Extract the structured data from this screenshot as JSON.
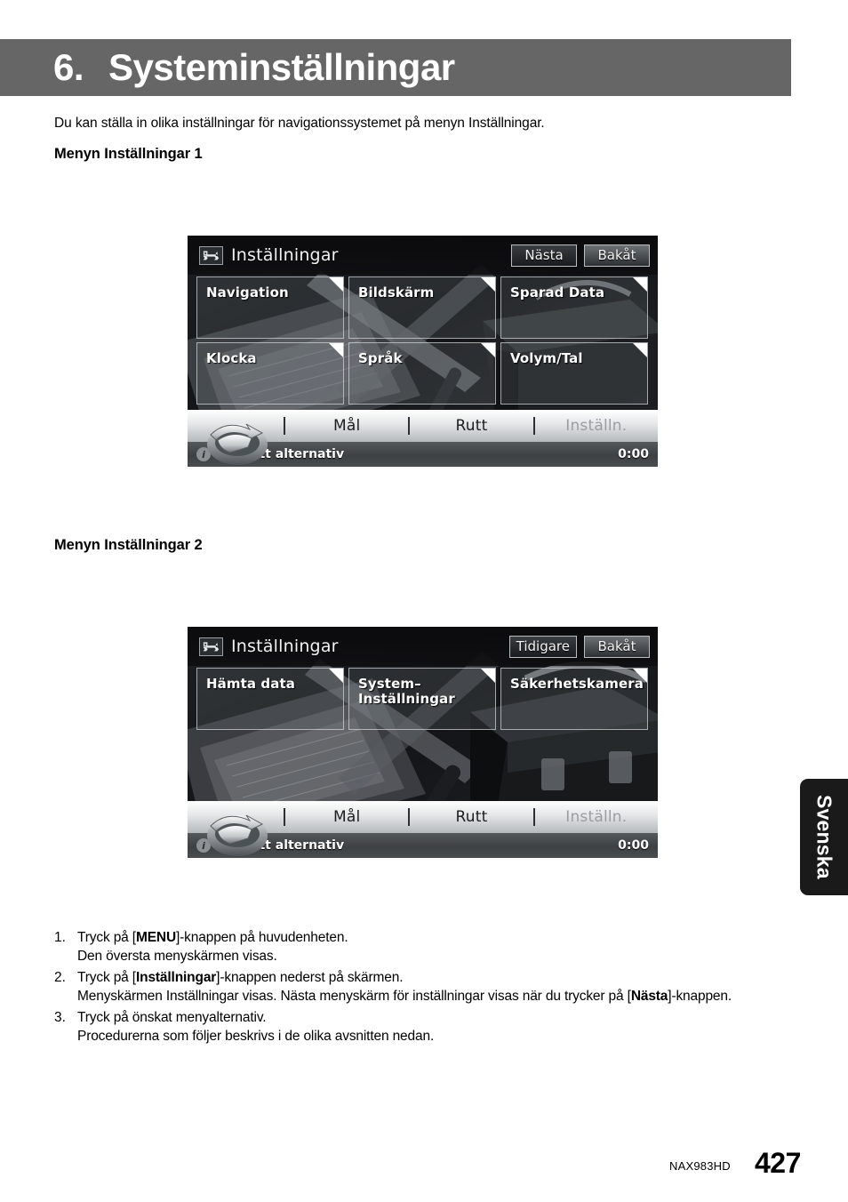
{
  "chapter": {
    "number": "6.",
    "title": "Systeminställningar"
  },
  "intro": "Du kan ställa in olika inställningar för navigationssystemet på menyn Inställningar.",
  "sections": [
    {
      "heading": "Menyn Inställningar 1"
    },
    {
      "heading": "Menyn Inställningar 2"
    }
  ],
  "screens": [
    {
      "title": "Inställningar",
      "icon": "wrench-icon",
      "header_buttons": [
        {
          "label": "Nästa",
          "state": "normal"
        },
        {
          "label": "Bakåt",
          "state": "pressed"
        }
      ],
      "tiles": [
        {
          "label": "Navigation"
        },
        {
          "label": "Bildskärm"
        },
        {
          "label": "Sparad Data"
        },
        {
          "label": "Klocka"
        },
        {
          "label": "Språk"
        },
        {
          "label": "Volym/Tal"
        }
      ],
      "navbar": [
        {
          "label": "Mål",
          "disabled": false
        },
        {
          "label": "Rutt",
          "disabled": false
        },
        {
          "label": "Inställn.",
          "disabled": true
        }
      ],
      "status": {
        "icon": "info-icon",
        "message": "Välj ett alternativ",
        "clock": "0:00"
      }
    },
    {
      "title": "Inställningar",
      "icon": "wrench-icon",
      "header_buttons": [
        {
          "label": "Tidigare",
          "state": "normal"
        },
        {
          "label": "Bakåt",
          "state": "pressed"
        }
      ],
      "tiles": [
        {
          "label": "Hämta data"
        },
        {
          "label": "System–\nInställningar"
        },
        {
          "label": "Säkerhetskamera"
        }
      ],
      "navbar": [
        {
          "label": "Mål",
          "disabled": false
        },
        {
          "label": "Rutt",
          "disabled": false
        },
        {
          "label": "Inställn.",
          "disabled": true
        }
      ],
      "status": {
        "icon": "info-icon",
        "message": "Välj ett alternativ",
        "clock": "0:00"
      }
    }
  ],
  "steps": [
    {
      "number": "1.",
      "line1_pre": "Tryck på [",
      "line1_bold": "MENU",
      "line1_post": "]-knappen på huvudenheten.",
      "line2": "Den översta menyskärmen visas."
    },
    {
      "number": "2.",
      "line1_pre": "Tryck på [",
      "line1_bold": "Inställningar",
      "line1_post": "]-knappen nederst på skärmen.",
      "line2_pre": "Menyskärmen Inställningar visas. Nästa menyskärm för inställningar visas när du trycker på [",
      "line2_bold": "Nästa",
      "line2_post": "]-knappen."
    },
    {
      "number": "3.",
      "line1_pre": "Tryck på önskat menyalternativ.",
      "line2": "Procedurerna som följer beskrivs i de olika avsnitten nedan."
    }
  ],
  "language_tab": "Svenska",
  "footer": {
    "model": "NAX983HD",
    "page": "427"
  },
  "colors": {
    "banner": "#666666",
    "screen_bg": "#0b0b0c",
    "tab_bg": "#1a1a1a"
  }
}
